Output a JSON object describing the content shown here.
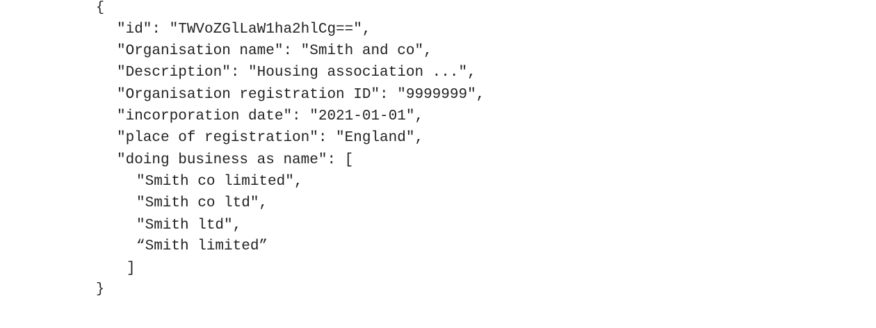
{
  "document": {
    "open_brace": "{",
    "lines": [
      "\"id\": \"TWVoZGlLaW1ha2hlCg==\",",
      "\"Organisation name\": \"Smith and co\",",
      "\"Description\": \"Housing association ...\",",
      "\"Organisation registration ID\": \"9999999\",",
      "\"incorporation date\": \"2021-01-01\",",
      "\"place of registration\": \"England\",",
      "\"doing business as name\": ["
    ],
    "array_items": [
      "\"Smith co limited\",",
      "\"Smith co ltd\",",
      "\"Smith ltd\",",
      "“Smith limited”"
    ],
    "array_close": "]",
    "close_brace": "}"
  }
}
